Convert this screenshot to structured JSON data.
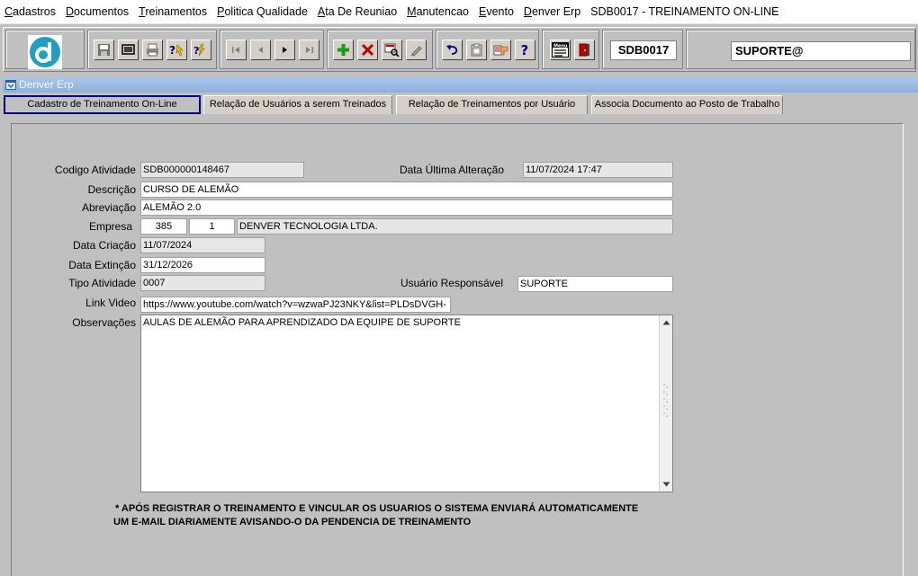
{
  "menu": {
    "items": [
      {
        "first": "C",
        "rest": "adastros"
      },
      {
        "first": "D",
        "rest": "ocumentos"
      },
      {
        "first": "T",
        "rest": "reinamentos"
      },
      {
        "first": "P",
        "rest": "olitica Qualidade"
      },
      {
        "first": "A",
        "rest": "ta De Reuniao"
      },
      {
        "first": "M",
        "rest": "anutencao"
      },
      {
        "first": "E",
        "rest": "vento"
      },
      {
        "first": "D",
        "rest": "enver Erp"
      }
    ],
    "window_title": "SDB0017 - TREINAMENTO ON-LINE"
  },
  "toolbar": {
    "screen_code": "SDB0017",
    "user": "SUPORTE@",
    "icons": [
      "logo-icon",
      "save-icon",
      "screen-icon",
      "print-icon",
      "query-icon",
      "execute-query-icon",
      "first-record-icon",
      "previous-record-icon",
      "next-record-icon",
      "last-record-icon",
      "insert-record-icon",
      "delete-record-icon",
      "search-icon",
      "clear-icon",
      "undo-icon",
      "paste-icon",
      "list-values-icon",
      "help-icon",
      "menu-icon",
      "exit-icon"
    ]
  },
  "window": {
    "title": "Denver Erp"
  },
  "tabs": [
    {
      "label": "Cadastro de Treinamento On-Line"
    },
    {
      "label": "Relação de Usuários a serem Treinados"
    },
    {
      "label": "Relação de Treinamentos por Usuário"
    },
    {
      "label": "Associa Documento ao Posto de Trabalho"
    }
  ],
  "form": {
    "codigo_atividade": {
      "label": "Codigo Atividade",
      "value": "SDB000000148467"
    },
    "data_ultima_alteracao": {
      "label": "Data Última Alteração",
      "value": "11/07/2024 17:47"
    },
    "descricao": {
      "label": "Descrição",
      "value": "CURSO DE ALEMÃO"
    },
    "abreviacao": {
      "label": "Abreviação",
      "value": "ALEMÃO 2.0"
    },
    "empresa": {
      "label": "Empresa",
      "code": "385",
      "branch": "1",
      "name": "DENVER TECNOLOGIA LTDA."
    },
    "data_criacao": {
      "label": "Data Criação",
      "value": "11/07/2024"
    },
    "data_extincao": {
      "label": "Data Extinção",
      "value": "31/12/2026"
    },
    "tipo_atividade": {
      "label": "Tipo Atividade",
      "value": "0007"
    },
    "usuario_responsavel": {
      "label": "Usuário Responsável",
      "value": "SUPORTE"
    },
    "link_video": {
      "label": "Link Video",
      "value": "https://www.youtube.com/watch?v=wzwaPJ23NKY&list=PLDsDVGH-"
    },
    "observacoes": {
      "label": "Observações",
      "value": "AULAS DE ALEMÃO PARA APRENDIZADO DA EQUIPE DE SUPORTE"
    }
  },
  "notes": {
    "line1": "* APÓS REGISTRAR O TREINAMENTO E VINCULAR OS USUARIOS O SISTEMA ENVIARÁ AUTOMATICAMENTE",
    "line2": "UM E-MAIL DIARIAMENTE AVISANDO-O DA PENDENCIA DE TREINAMENTO"
  }
}
